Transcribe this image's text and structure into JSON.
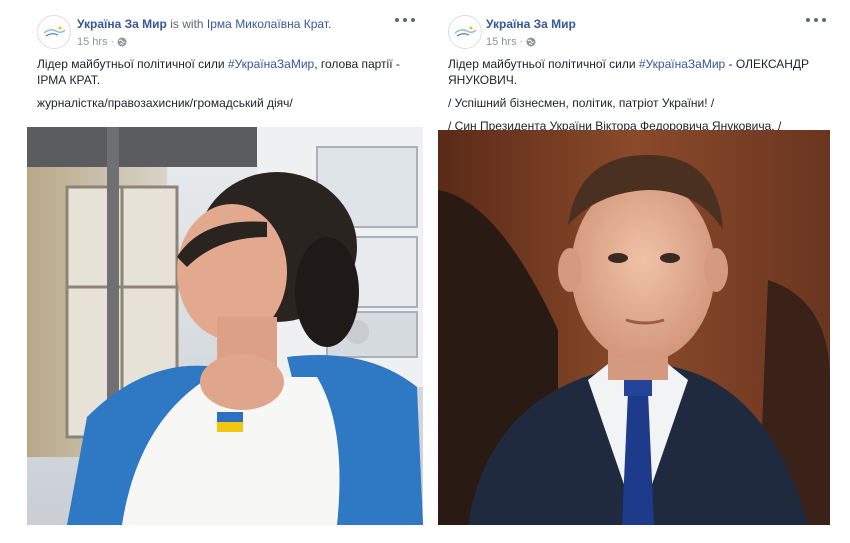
{
  "posts": [
    {
      "page_name": "Україна За Мир",
      "with_text": "is with",
      "tagged_name": "Ірма Миколаївна Крат.",
      "timestamp": "15 hrs",
      "privacy_icon": "globe-icon",
      "line1_before": "Лідер майбутньої політичної сили ",
      "hashtag": "#УкраїнаЗаМир",
      "line1_after": ", голова партії - ІРМА КРАТ.",
      "line2": "журналістка/правозахисник/громадський діяч/",
      "photo_icon": "woman-portrait-photo"
    },
    {
      "page_name": "Україна За Мир",
      "timestamp": "15 hrs",
      "privacy_icon": "globe-icon",
      "line1_before": "Лідер майбутньої політичної сили ",
      "hashtag": "#УкраїнаЗаМир",
      "line1_after": " - ОЛЕКСАНДР ЯНУКОВИЧ.",
      "line2": "/ Успішний бізнесмен, політик, патріот України! /",
      "line3": "/ Син Президента України Віктора Федоровича Януковича. /",
      "photo_icon": "man-portrait-photo"
    }
  ],
  "colors": {
    "link": "#365899",
    "meta": "#90949c",
    "text": "#1d2129"
  }
}
